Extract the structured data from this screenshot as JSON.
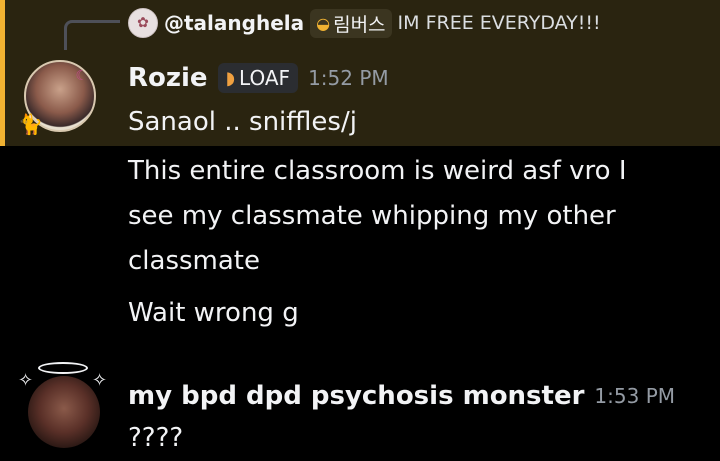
{
  "reply": {
    "username": "@talanghela",
    "tag_icon": "helmet-icon",
    "tag_label": "림버스",
    "text": "IM FREE EVERYDAY!!!"
  },
  "messages": [
    {
      "username": "Rozie",
      "badge_icon": "bread-icon",
      "badge_label": "LOAF",
      "timestamp": "1:52 PM",
      "lines": [
        "Sanaol .. sniffles/j",
        "This entire classroom is weird asf vro I",
        "see my classmate whipping my other",
        "classmate",
        "Wait wrong g"
      ]
    },
    {
      "username": "my bpd dpd psychosis monster",
      "timestamp": "1:53 PM",
      "lines": [
        "????"
      ]
    }
  ],
  "colors": {
    "background": "#000000",
    "mention_highlight": "#2a2410",
    "mention_bar": "#f0b232",
    "timestamp": "#949ba4"
  }
}
